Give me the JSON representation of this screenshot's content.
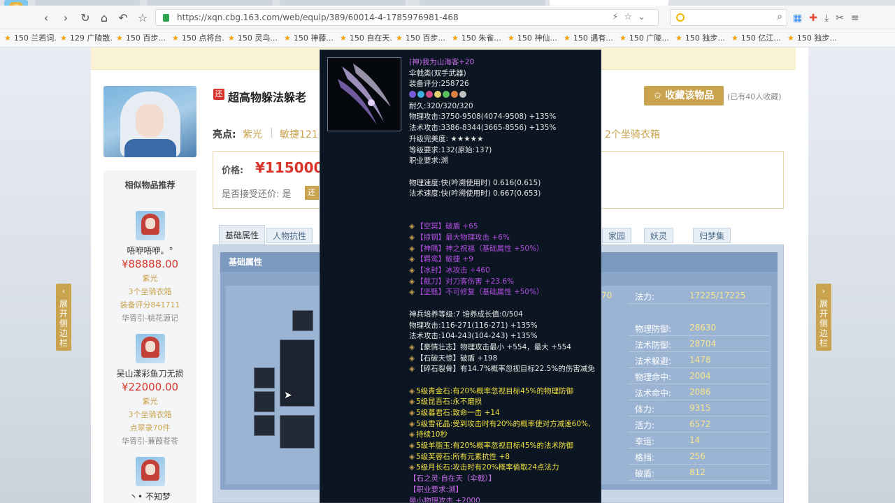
{
  "browser": {
    "url": "https://xqn.cbg.163.com/web/equip/389/60014-4-1785976981-468",
    "bookmarks": [
      "150 兰若词...",
      "129 广陵散...",
      "150 百步...",
      "150 点将台...",
      "150 灵鸟...",
      "150 神藤...",
      "150 自在天...",
      "150 百步...",
      "150 朱雀...",
      "150 神仙...",
      "150 遇有...",
      "150 广陵...",
      "150 独步...",
      "150 亿江...",
      "150 独步..."
    ]
  },
  "page": {
    "title": "超高物躲法躲老",
    "title_tag": "还",
    "favorite_label": "收藏该物品",
    "favorite_count": "(已有40人收藏)",
    "highlights_label": "亮点:",
    "highlights": [
      "紫光",
      "敏捷121",
      "2个坐骑衣箱"
    ],
    "price_label": "价格:",
    "price": "¥115000.0",
    "bargain_label": "是否接受还价: 是",
    "bargain_btn": "还"
  },
  "similar": {
    "title": "相似物品推荐",
    "items": [
      {
        "name": "唔咿唔咿。°",
        "price": "¥88888.00",
        "l1": "紫光",
        "l2": "3个坐骑衣箱",
        "l3": "装备评分841711",
        "l4": "华胥引-桃花源记"
      },
      {
        "name": "吴山漾彩鱼刀无损",
        "price": "¥22000.00",
        "l1": "紫光",
        "l2": "3个坐骑衣箱",
        "l3": "点翠录70件",
        "l4": "华胥引-蒹葭苍苍"
      },
      {
        "name": "丶• 不知梦",
        "price": "",
        "l1": "",
        "l2": "",
        "l3": "",
        "l4": ""
      }
    ]
  },
  "side_tabs": {
    "left": "展开侧边栏",
    "right": "展开侧边栏"
  },
  "tabs": [
    "基础属性",
    "人物抗性",
    "家园",
    "妖灵",
    "归梦集"
  ],
  "attr": {
    "header": "基础属性",
    "partial": "70",
    "stats": [
      {
        "label": "法力:",
        "value": "17225/17225"
      },
      {
        "label": "物理防御:",
        "value": "28630"
      },
      {
        "label": "法术防御:",
        "value": "28704"
      },
      {
        "label": "法术躲避:",
        "value": "1478"
      },
      {
        "label": "物理命中:",
        "value": "2004"
      },
      {
        "label": "法术命中:",
        "value": "2086"
      },
      {
        "label": "体力:",
        "value": "9315"
      },
      {
        "label": "活力:",
        "value": "6572"
      },
      {
        "label": "幸运:",
        "value": "14"
      },
      {
        "label": "格挡:",
        "value": "256"
      },
      {
        "label": "破盾:",
        "value": "812"
      }
    ]
  },
  "tooltip": {
    "lines": [
      {
        "t": "(神)我为山海客+20",
        "c": "purple"
      },
      {
        "t": "伞戟类(双手武器)",
        "c": "white"
      },
      {
        "t": "装备评分:258726",
        "c": "white"
      },
      {
        "t": "",
        "c": "gems"
      },
      {
        "t": "耐久:320/320/320",
        "c": "white"
      },
      {
        "t": "物理攻击:3750-9508(4074-9508) +135%",
        "c": "white"
      },
      {
        "t": "法术攻击:3386-8344(3665-8556) +135%",
        "c": "white"
      },
      {
        "t": "升级完美度: ★★★★★",
        "c": "white"
      },
      {
        "t": "等级要求:132(原始:137)",
        "c": "white"
      },
      {
        "t": "职业要求:溯",
        "c": "white"
      },
      {
        "t": "",
        "c": "white"
      },
      {
        "t": "物理速度:快(吟溯使用时) 0.616(0.615)",
        "c": "white"
      },
      {
        "t": "法术速度:快(吟溯使用时) 0.667(0.653)",
        "c": "white"
      },
      {
        "t": "",
        "c": "white"
      },
      {
        "t": "",
        "c": "white"
      },
      {
        "t": "【空冥】破盾 +65",
        "c": "magenta"
      },
      {
        "t": "【掠钢】最大物理攻击 +6%",
        "c": "magenta"
      },
      {
        "t": "【神隅】神之祝福（基础属性 +50%）",
        "c": "magenta"
      },
      {
        "t": "【羁鸾】敏捷 +9",
        "c": "magenta"
      },
      {
        "t": "【冰封】冰攻击 +460",
        "c": "magenta"
      },
      {
        "t": "【截刀】对刀客伤害 +23.6%",
        "c": "magenta"
      },
      {
        "t": "【坚甄】不可修复（基础属性 +50%）",
        "c": "magenta"
      },
      {
        "t": "",
        "c": "white"
      },
      {
        "t": "神兵培养等级:7 培养成长值:0/504",
        "c": "white"
      },
      {
        "t": "物理攻击:116-271(116-271) +135%",
        "c": "white"
      },
      {
        "t": "法术攻击:104-243(104-243) +135%",
        "c": "white"
      },
      {
        "t": "【豪情壮志】物理攻击最小 +554，最大 +554",
        "c": "white"
      },
      {
        "t": "【石破天惊】破盾 +198",
        "c": "white"
      },
      {
        "t": "【碎石裂骨】有14.7%概率忽视目标22.5%的伤害减免",
        "c": "white"
      },
      {
        "t": "",
        "c": "white"
      },
      {
        "t": "5级青金石:有20%概率忽视目标45%的物理防御",
        "c": "yellow"
      },
      {
        "t": "5级昆吾石:永不磨损",
        "c": "yellow"
      },
      {
        "t": "5级暮君石:致命一击 +14",
        "c": "yellow"
      },
      {
        "t": "5级雪花晶:受到攻击时有20%的概率使对方减速60%,",
        "c": "yellow"
      },
      {
        "t": "持续10秒",
        "c": "yellow"
      },
      {
        "t": "5级羊脂玉:有20%概率忽视目标45%的法术防御",
        "c": "yellow"
      },
      {
        "t": "5级芙蓉石:所有元素抗性 +8",
        "c": "yellow"
      },
      {
        "t": "5级月长石:攻击时有20%概率偷取24点法力",
        "c": "yellow"
      },
      {
        "t": "【石之灵·自在天（伞戟）】",
        "c": "purple"
      },
      {
        "t": "【职业要求:溯】",
        "c": "purple"
      },
      {
        "t": "最小物理攻击 +2000",
        "c": "purple"
      }
    ]
  },
  "colors": {
    "gold": "#c9a34e",
    "price_red": "#d9342b"
  }
}
